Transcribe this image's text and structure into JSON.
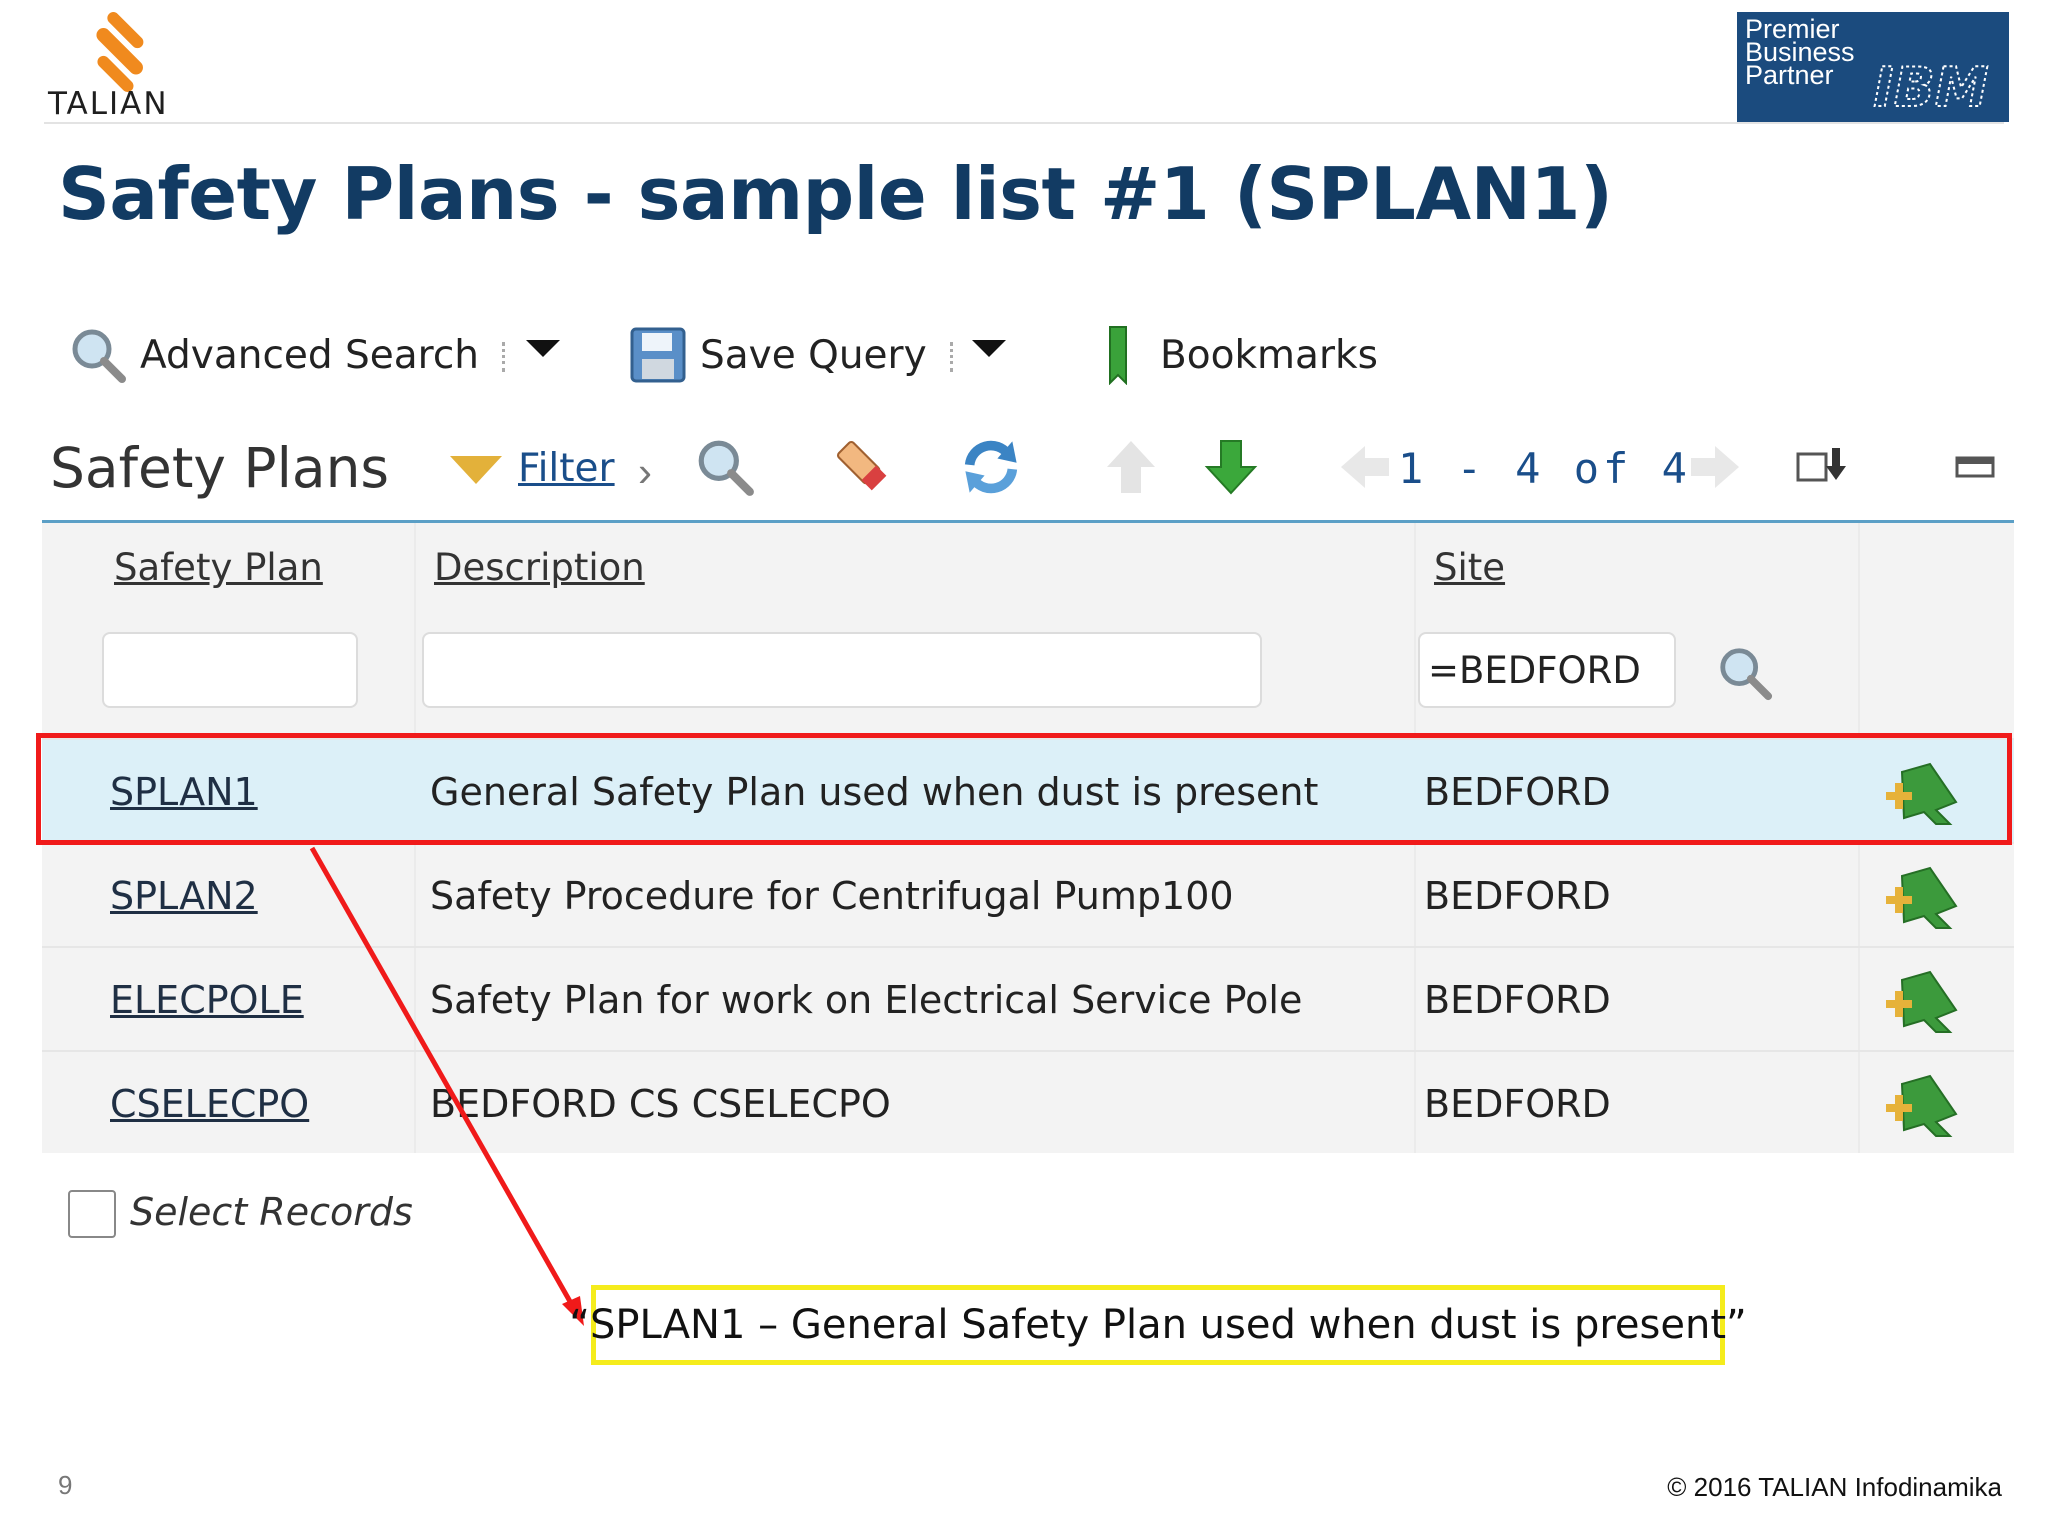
{
  "brand": {
    "name": "TALIAN",
    "logo_icon": "talian-logo-icon"
  },
  "partner_badge": {
    "lines": [
      "Premier",
      "Business",
      "Partner"
    ],
    "mark": "IBM",
    "color": "#1b4b7e"
  },
  "slide": {
    "title": "Safety Plans - sample list #1 (SPLAN1)",
    "page_number": "9",
    "copyright": "© 2016 TALIAN Infodinamika"
  },
  "toolbar": {
    "advanced_search": "Advanced Search",
    "save_query": "Save Query",
    "bookmarks": "Bookmarks"
  },
  "list": {
    "title": "Safety Plans",
    "filter_label": "Filter",
    "pager": "1 - 4 of 4",
    "columns": [
      "Safety Plan",
      "Description",
      "Site"
    ],
    "filters": {
      "safety_plan": "",
      "description": "",
      "site": "=BEDFORD"
    },
    "rows": [
      {
        "plan": "SPLAN1",
        "description": "General Safety Plan used when dust is present",
        "site": "BEDFORD",
        "selected": true
      },
      {
        "plan": "SPLAN2",
        "description": "Safety Procedure for Centrifugal Pump100",
        "site": "BEDFORD",
        "selected": false
      },
      {
        "plan": "ELECPOLE",
        "description": "Safety Plan for work on Electrical Service Pole",
        "site": "BEDFORD",
        "selected": false
      },
      {
        "plan": "CSELECPO",
        "description": "BEDFORD CS CSELECPO",
        "site": "BEDFORD",
        "selected": false
      }
    ],
    "select_records": "Select Records"
  },
  "annotation": {
    "callout": "“SPLAN1 – General Safety Plan used when dust is present”",
    "highlight_color": "#f01a1a",
    "callout_border_color": "#f5ec1c"
  },
  "colors": {
    "title": "#123b63",
    "link": "#1a4e8a",
    "accent_rule": "#5b9fc6",
    "selected_row": "#dcf0f8"
  }
}
